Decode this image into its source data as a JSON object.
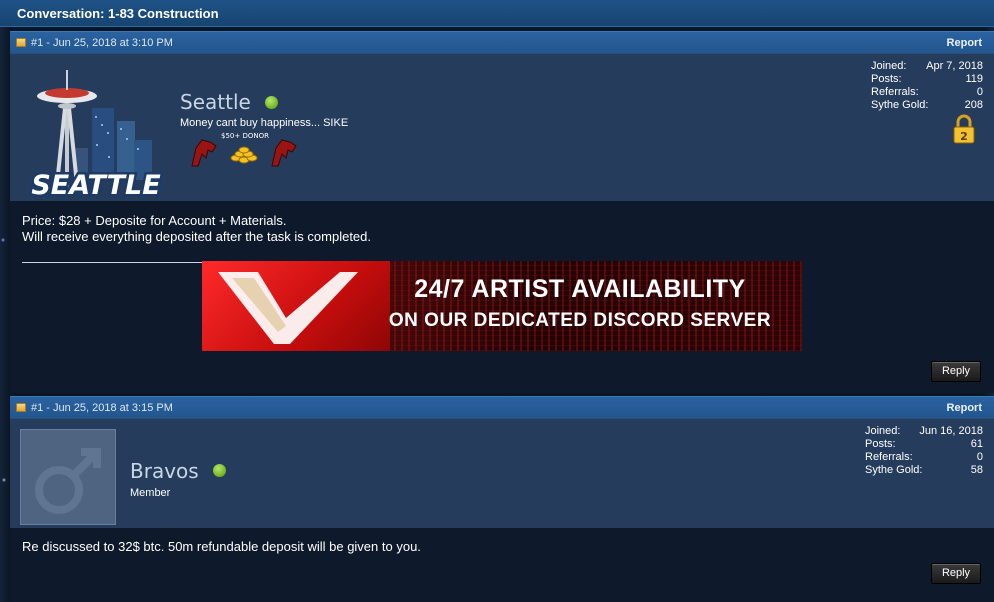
{
  "conversation": {
    "title": "Conversation: 1-83 Construction"
  },
  "posts": [
    {
      "meta": "#1 - Jun 25, 2018 at 3:10 PM",
      "report_label": "Report",
      "username": "Seattle",
      "avatar_text": "SEATTLE",
      "usertitle": "Money cant buy happiness... SIKE",
      "badge_text": "$50+ DONOR",
      "stats": {
        "joined_label": "Joined:",
        "joined": "Apr 7, 2018",
        "posts_label": "Posts:",
        "posts": "119",
        "referrals_label": "Referrals:",
        "referrals": "0",
        "gold_label": "Sythe Gold:",
        "gold": "208"
      },
      "body_line1": "Price: $28 + Deposite for Account + Materials.",
      "body_line2": "Will receive everything deposited after the task is completed.",
      "banner": {
        "line1": "24/7 ARTIST AVAILABILITY",
        "line2": "ON OUR DEDICATED DISCORD SERVER"
      },
      "reply_label": "Reply"
    },
    {
      "meta": "#1 - Jun 25, 2018 at 3:15 PM",
      "report_label": "Report",
      "username": "Bravos",
      "usertitle": "Member",
      "stats": {
        "joined_label": "Joined:",
        "joined": "Jun 16, 2018",
        "posts_label": "Posts:",
        "posts": "61",
        "referrals_label": "Referrals:",
        "referrals": "0",
        "gold_label": "Sythe Gold:",
        "gold": "58"
      },
      "body": "Re discussed to 32$ btc. 50m refundable deposit will be given to you.",
      "reply_label": "Reply"
    }
  ],
  "colors": {
    "online": "#7dbb2a",
    "header": "#1f5286",
    "userbar": "#253c5c"
  }
}
